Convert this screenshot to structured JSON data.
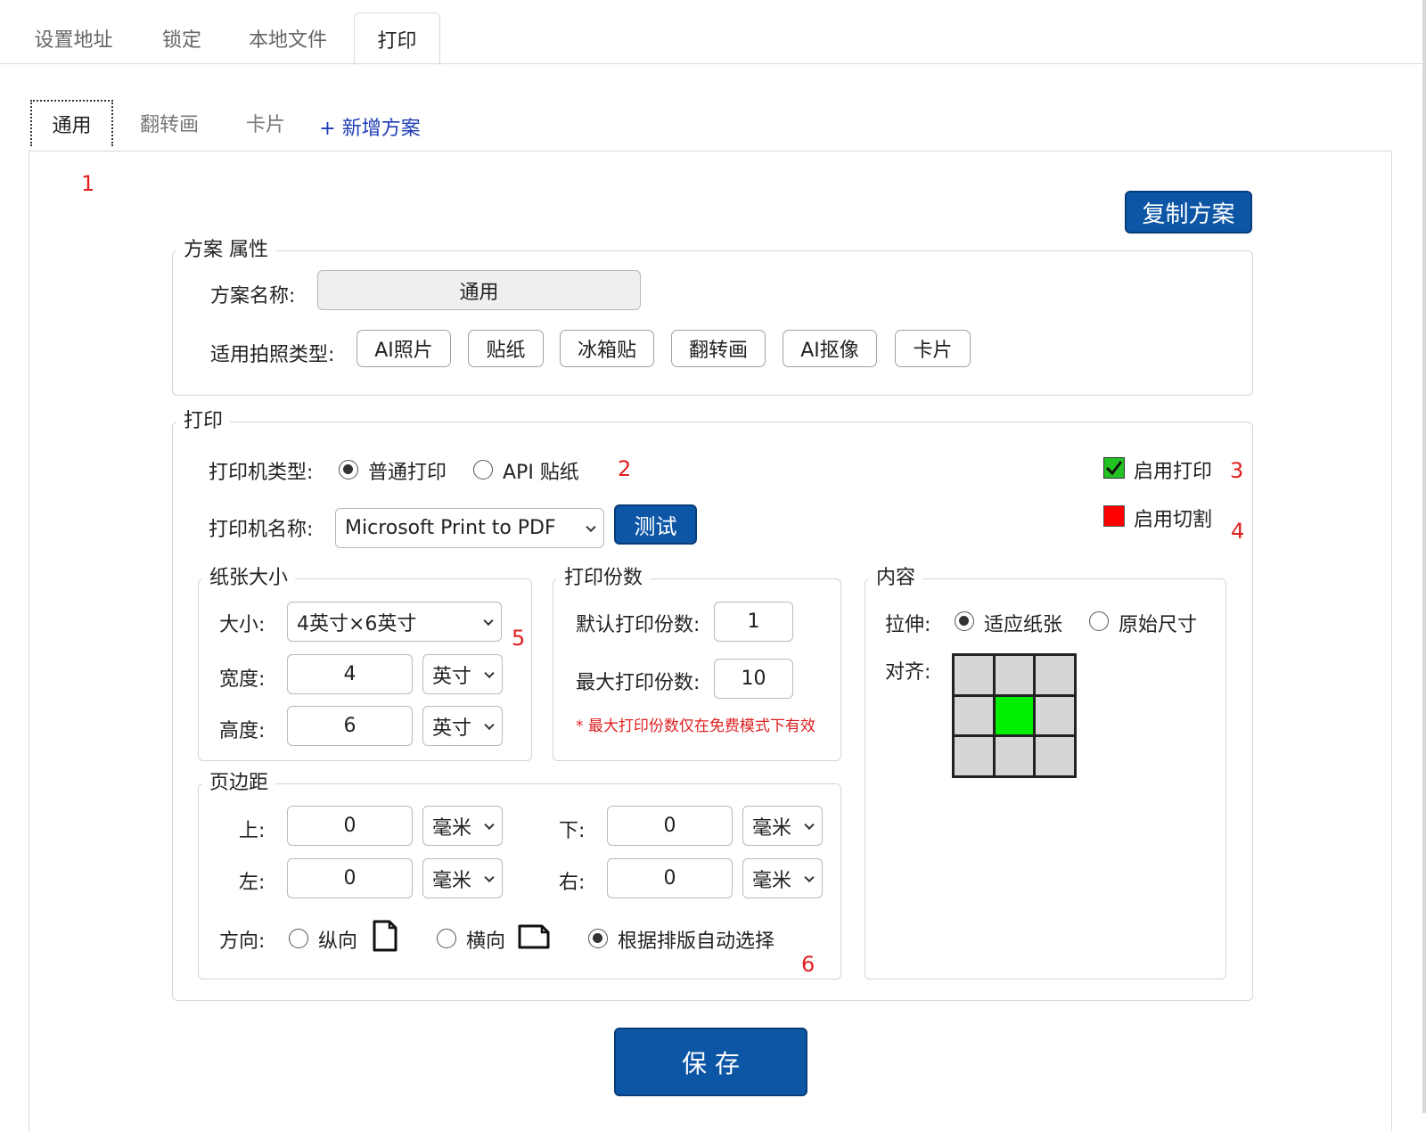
{
  "top_tabs": [
    "设置地址",
    "锁定",
    "本地文件",
    "打印"
  ],
  "sub_tabs": [
    "通用",
    "翻转画",
    "卡片"
  ],
  "add_plan_label": "+ 新增方案",
  "markers": [
    "1",
    "2",
    "3",
    "4",
    "5",
    "6"
  ],
  "copy_plan_label": "复制方案",
  "plan_props": {
    "legend": "方案 属性",
    "name_label": "方案名称:",
    "name_value": "通用",
    "types_label": "适用拍照类型:",
    "types": [
      "AI照片",
      "贴纸",
      "冰箱贴",
      "翻转画",
      "AI抠像",
      "卡片"
    ]
  },
  "print": {
    "legend": "打印",
    "printer_type_label": "打印机类型:",
    "printer_type_options": [
      "普通打印",
      "API 贴纸"
    ],
    "printer_type_selected": "普通打印",
    "enable_print_label": "启用打印",
    "enable_print_checked": true,
    "enable_cut_label": "启用切割",
    "printer_name_label": "打印机名称:",
    "printer_name_value": "Microsoft Print to PDF",
    "test_label": "测试"
  },
  "paper": {
    "legend": "纸张大小",
    "size_label": "大小:",
    "size_value": "4英寸×6英寸",
    "width_label": "宽度:",
    "width_value": "4",
    "width_unit": "英寸",
    "height_label": "高度:",
    "height_value": "6",
    "height_unit": "英寸"
  },
  "copies": {
    "legend": "打印份数",
    "default_label": "默认打印份数:",
    "default_value": "1",
    "max_label": "最大打印份数:",
    "max_value": "10",
    "note": "* 最大打印份数仅在免费模式下有效"
  },
  "margin": {
    "legend": "页边距",
    "top_label": "上:",
    "top_value": "0",
    "top_unit": "毫米",
    "bottom_label": "下:",
    "bottom_value": "0",
    "bottom_unit": "毫米",
    "left_label": "左:",
    "left_value": "0",
    "left_unit": "毫米",
    "right_label": "右:",
    "right_value": "0",
    "right_unit": "毫米",
    "orientation_label": "方向:",
    "orientation_options": [
      "纵向",
      "横向",
      "根据排版自动选择"
    ],
    "orientation_selected": "根据排版自动选择"
  },
  "content": {
    "legend": "内容",
    "stretch_label": "拉伸:",
    "stretch_options": [
      "适应纸张",
      "原始尺寸"
    ],
    "stretch_selected": "适应纸张",
    "align_label": "对齐:",
    "align_selected": "center"
  },
  "save_label": "保 存",
  "colors": {
    "primary": "#0d56a6",
    "marker": "#e02020",
    "align_selected": "#00ee00",
    "cut_indicator": "#ff0000",
    "check_green": "#22c322",
    "link": "#1f3db5"
  },
  "icons": [
    "checkmark-icon",
    "chevron-down-icon",
    "portrait-page-icon",
    "landscape-page-icon"
  ]
}
